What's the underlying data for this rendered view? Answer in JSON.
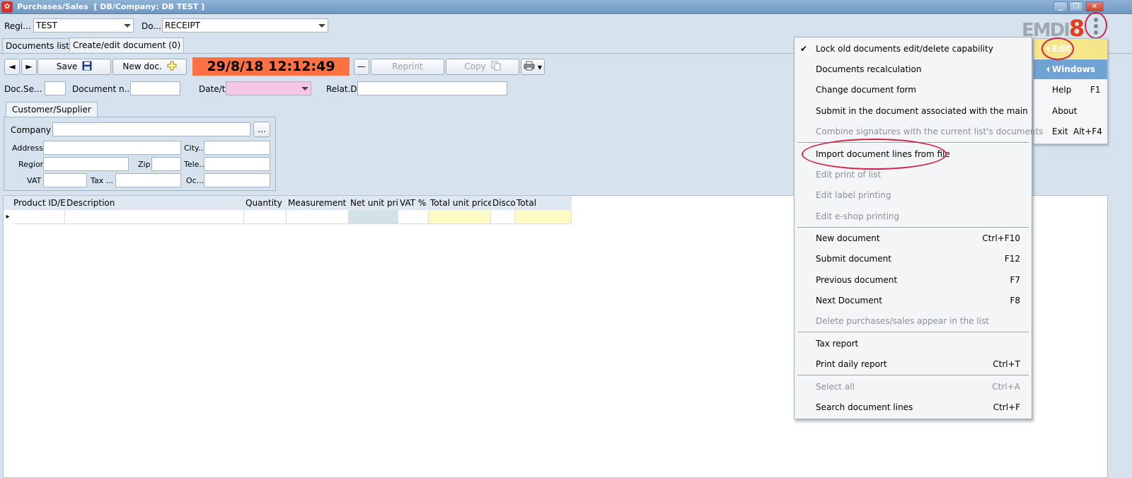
{
  "window": {
    "title": "Purchases/Sales  [ DB/Company: DB TEST ]",
    "min_label": "_",
    "restore_label": "❐",
    "close_label": "✕"
  },
  "top": {
    "register_label": "Regi...",
    "register_value": "TEST",
    "doctype_label": "Do...",
    "doctype_value": "RECEIPT"
  },
  "tabs": {
    "documents_list": "Documents list",
    "create_edit": "Create/edit document (0)"
  },
  "toolbar": {
    "prev_label": "◄",
    "next_label": "►",
    "save_label": "Save",
    "new_doc_label": "New doc.",
    "datetime": "29/8/18 12:12:49",
    "minus_label": "—",
    "reprint_label": "Reprint",
    "copy_label": "Copy"
  },
  "docfields": {
    "doc_series_label": "Doc.Se...",
    "document_number_label": "Document n...",
    "datetime_label": "Date/ti",
    "related_label": "Relat.D"
  },
  "customer": {
    "tab_label": "Customer/Supplier",
    "company_label": "Company",
    "browse_label": "...",
    "address_label": "Address",
    "city_label": "City...",
    "region_label": "Region",
    "zip_label": "Zip",
    "phone_label": "Tele...",
    "vat_label": "VAT",
    "tax_label": "Tax ...",
    "occupation_label": "Oc..."
  },
  "grid": {
    "columns": [
      "Product ID/E",
      "Description",
      "Quantity",
      "Measurement u",
      "Net unit pric",
      "VAT %",
      "Total unit price",
      "Disco",
      "Total"
    ],
    "row_indicator": "▸"
  },
  "logo": {
    "text": "EMDI",
    "number": "8"
  },
  "main_menu": {
    "edit": "Edit",
    "windows": "Windows",
    "help": "Help",
    "help_shortcut": "F1",
    "about": "About",
    "exit": "Exit",
    "exit_shortcut": "Alt+F4"
  },
  "submenu": {
    "check_mark": "✔",
    "items": [
      {
        "label": "Lock old documents edit/delete capability",
        "shortcut": ""
      },
      {
        "label": "Documents recalculation",
        "shortcut": ""
      },
      {
        "label": "Change document form",
        "shortcut": ""
      },
      {
        "label": "Submit in the document associated with the main",
        "shortcut": ""
      },
      {
        "label": "Combine signatures with the current list's documents",
        "shortcut": ""
      },
      {
        "label": "Import document lines from file",
        "shortcut": ""
      },
      {
        "label": "Edit print of list",
        "shortcut": ""
      },
      {
        "label": "Edit label printing",
        "shortcut": ""
      },
      {
        "label": "Edit e-shop printing",
        "shortcut": ""
      },
      {
        "label": "New document",
        "shortcut": "Ctrl+F10"
      },
      {
        "label": "Submit document",
        "shortcut": "F12"
      },
      {
        "label": "Previous document",
        "shortcut": "F7"
      },
      {
        "label": "Next Document",
        "shortcut": "F8"
      },
      {
        "label": "Delete purchases/sales appear in the list",
        "shortcut": ""
      },
      {
        "label": "Tax report",
        "shortcut": ""
      },
      {
        "label": "Print daily report",
        "shortcut": "Ctrl+T"
      },
      {
        "label": "Select all",
        "shortcut": "Ctrl+A"
      },
      {
        "label": "Search document lines",
        "shortcut": "Ctrl+F"
      }
    ]
  },
  "colors": {
    "accent_datetime": "#ff7043",
    "annotation_red": "#d1244a",
    "edit_highlight": "#f7e58a",
    "windows_highlight": "#6fa3d3"
  }
}
